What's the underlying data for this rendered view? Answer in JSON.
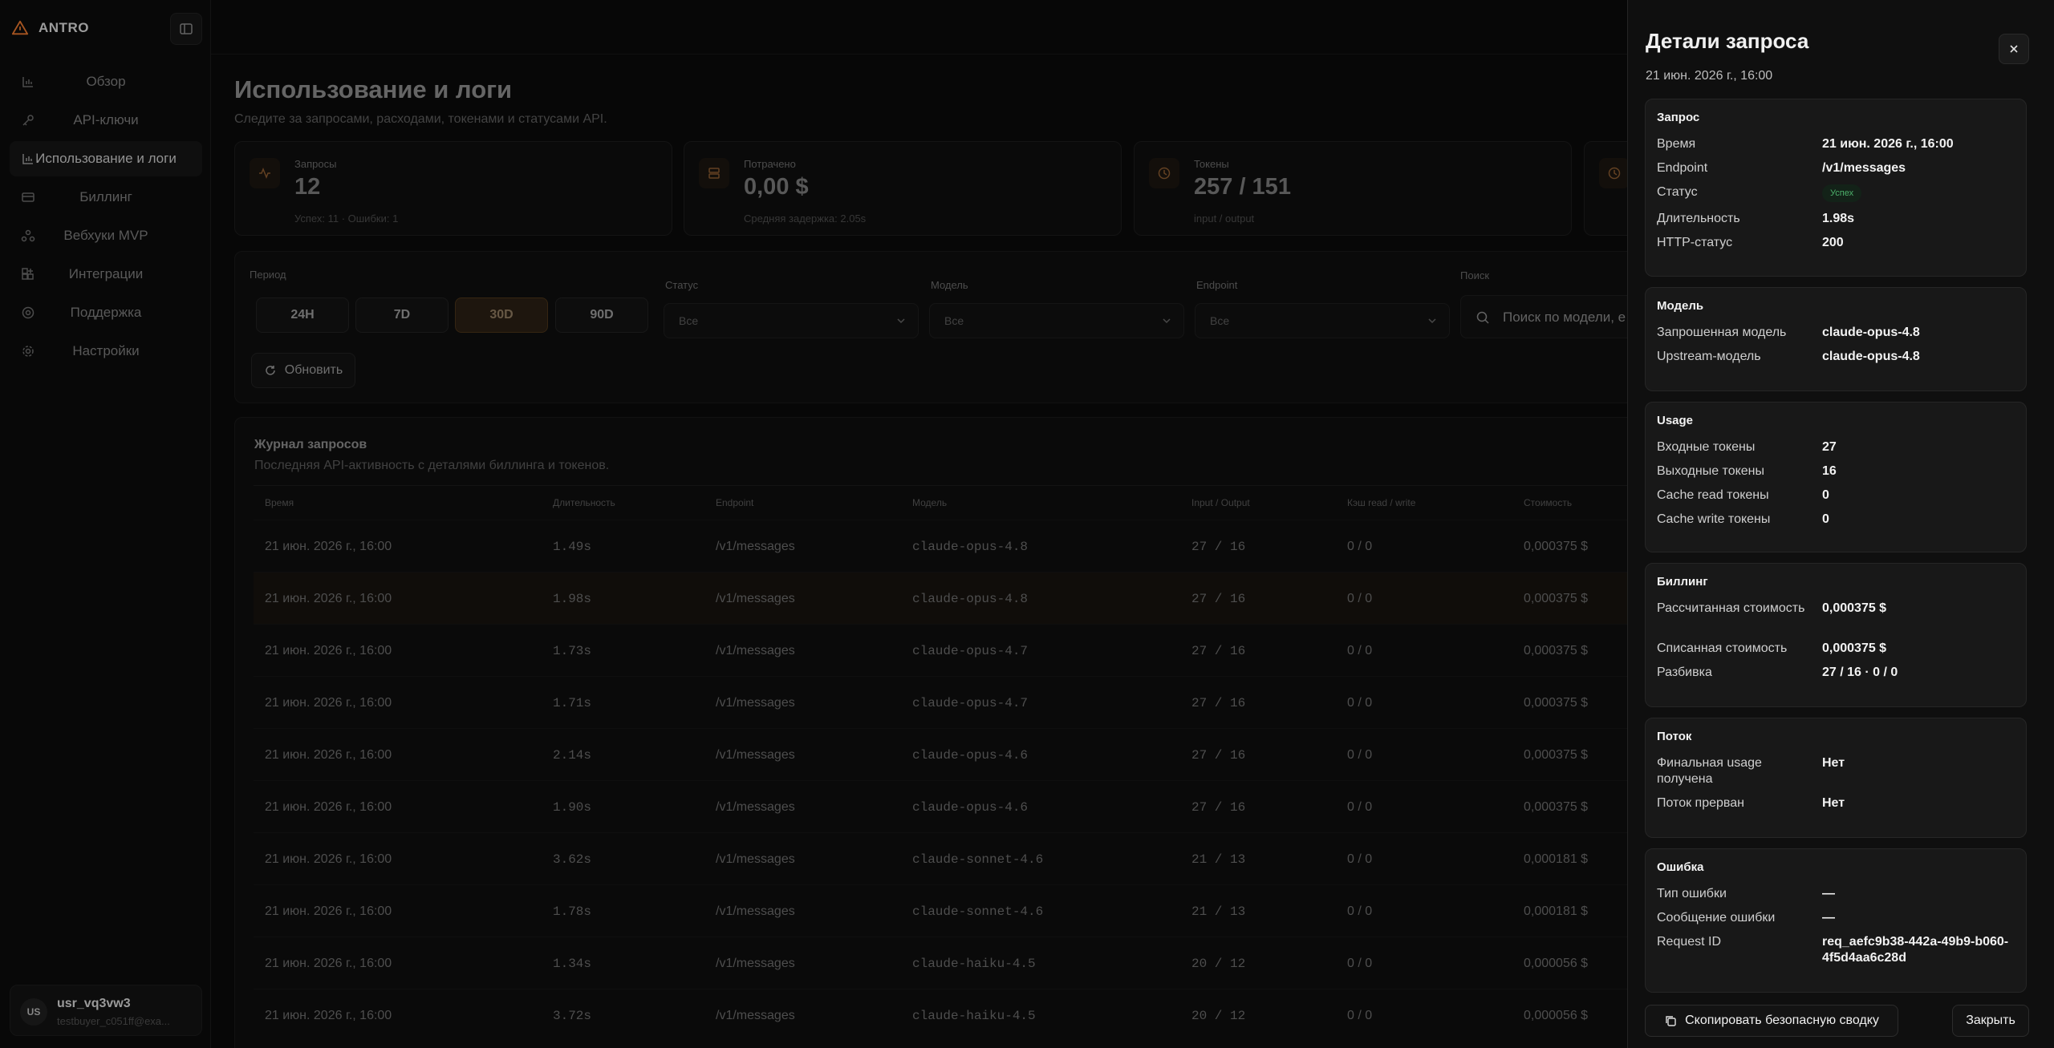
{
  "app": {
    "name": "ANTRO"
  },
  "sidebar": {
    "items": [
      {
        "label": "Обзор",
        "icon": "bar-chart-icon"
      },
      {
        "label": "API-ключи",
        "icon": "key-icon"
      },
      {
        "label": "Использование и логи",
        "icon": "bar-chart-icon",
        "active": true
      },
      {
        "label": "Биллинг",
        "icon": "credit-card-icon"
      },
      {
        "label": "Вебхуки MVP",
        "icon": "webhook-icon"
      },
      {
        "label": "Интеграции",
        "icon": "grid-plus-icon"
      },
      {
        "label": "Поддержка",
        "icon": "lifebuoy-icon"
      },
      {
        "label": "Настройки",
        "icon": "gear-icon"
      }
    ],
    "user": {
      "initials": "US",
      "name": "usr_vq3vw3",
      "email": "testbuyer_c051ff@exa..."
    }
  },
  "page": {
    "title": "Использование и логи",
    "subtitle": "Следите за запросами, расходами, токенами и статусами API."
  },
  "stats": [
    {
      "label": "Запросы",
      "value": "12",
      "sub": "Успех: 11 · Ошибки: 1",
      "icon": "activity-icon"
    },
    {
      "label": "Потрачено",
      "value": "0,00 $",
      "sub": "Средняя задержка: 2.05s",
      "icon": "stack-icon"
    },
    {
      "label": "Токены",
      "value": "257 / 151",
      "sub": "input / output",
      "icon": "clock-icon"
    },
    {
      "label": "",
      "value": "",
      "sub": "",
      "icon": "clock-icon"
    }
  ],
  "filters": {
    "period_label": "Период",
    "periods": [
      "24H",
      "7D",
      "30D",
      "90D"
    ],
    "active_period": "30D",
    "status_label": "Статус",
    "status_value": "Все",
    "model_label": "Модель",
    "model_value": "Все",
    "endpoint_label": "Endpoint",
    "endpoint_value": "Все",
    "search_label": "Поиск",
    "search_placeholder": "Поиск по модели, e",
    "refresh_label": "Обновить"
  },
  "log": {
    "title": "Журнал запросов",
    "subtitle": "Последняя API-активность с деталями биллинга и токенов.",
    "columns": [
      "Время",
      "Длительность",
      "Endpoint",
      "Модель",
      "Input / Output",
      "Кэш read / write",
      "Стоимость"
    ],
    "rows": [
      {
        "time": "21 июн. 2026 г., 16:00",
        "duration": "1.49s",
        "endpoint": "/v1/messages",
        "model": "claude-opus-4.8",
        "io": "27 / 16",
        "cache": "0 / 0",
        "cost": "0,000375 $"
      },
      {
        "time": "21 июн. 2026 г., 16:00",
        "duration": "1.98s",
        "endpoint": "/v1/messages",
        "model": "claude-opus-4.8",
        "io": "27 / 16",
        "cache": "0 / 0",
        "cost": "0,000375 $",
        "selected": true
      },
      {
        "time": "21 июн. 2026 г., 16:00",
        "duration": "1.73s",
        "endpoint": "/v1/messages",
        "model": "claude-opus-4.7",
        "io": "27 / 16",
        "cache": "0 / 0",
        "cost": "0,000375 $"
      },
      {
        "time": "21 июн. 2026 г., 16:00",
        "duration": "1.71s",
        "endpoint": "/v1/messages",
        "model": "claude-opus-4.7",
        "io": "27 / 16",
        "cache": "0 / 0",
        "cost": "0,000375 $"
      },
      {
        "time": "21 июн. 2026 г., 16:00",
        "duration": "2.14s",
        "endpoint": "/v1/messages",
        "model": "claude-opus-4.6",
        "io": "27 / 16",
        "cache": "0 / 0",
        "cost": "0,000375 $"
      },
      {
        "time": "21 июн. 2026 г., 16:00",
        "duration": "1.90s",
        "endpoint": "/v1/messages",
        "model": "claude-opus-4.6",
        "io": "27 / 16",
        "cache": "0 / 0",
        "cost": "0,000375 $"
      },
      {
        "time": "21 июн. 2026 г., 16:00",
        "duration": "3.62s",
        "endpoint": "/v1/messages",
        "model": "claude-sonnet-4.6",
        "io": "21 / 13",
        "cache": "0 / 0",
        "cost": "0,000181 $"
      },
      {
        "time": "21 июн. 2026 г., 16:00",
        "duration": "1.78s",
        "endpoint": "/v1/messages",
        "model": "claude-sonnet-4.6",
        "io": "21 / 13",
        "cache": "0 / 0",
        "cost": "0,000181 $"
      },
      {
        "time": "21 июн. 2026 г., 16:00",
        "duration": "1.34s",
        "endpoint": "/v1/messages",
        "model": "claude-haiku-4.5",
        "io": "20 / 12",
        "cache": "0 / 0",
        "cost": "0,000056 $"
      },
      {
        "time": "21 июн. 2026 г., 16:00",
        "duration": "3.72s",
        "endpoint": "/v1/messages",
        "model": "claude-haiku-4.5",
        "io": "20 / 12",
        "cache": "0 / 0",
        "cost": "0,000056 $"
      }
    ]
  },
  "panel": {
    "title": "Детали запроса",
    "date": "21 июн. 2026 г., 16:00",
    "sections": {
      "request": {
        "title": "Запрос",
        "rows": [
          {
            "k": "Время",
            "v": "21 июн. 2026 г., 16:00"
          },
          {
            "k": "Endpoint",
            "v": "/v1/messages"
          },
          {
            "k": "Статус",
            "v": "Успех"
          },
          {
            "k": "Длительность",
            "v": "1.98s"
          },
          {
            "k": "HTTP-статус",
            "v": "200"
          }
        ]
      },
      "model": {
        "title": "Модель",
        "rows": [
          {
            "k": "Запрошенная модель",
            "v": "claude-opus-4.8"
          },
          {
            "k": "Upstream-модель",
            "v": "claude-opus-4.8"
          }
        ]
      },
      "usage": {
        "title": "Usage",
        "rows": [
          {
            "k": "Входные токены",
            "v": "27"
          },
          {
            "k": "Выходные токены",
            "v": "16"
          },
          {
            "k": "Cache read токены",
            "v": "0"
          },
          {
            "k": "Cache write токены",
            "v": "0"
          }
        ]
      },
      "billing": {
        "title": "Биллинг",
        "rows": [
          {
            "k": "Рассчитанная стоимость",
            "v": "0,000375 $"
          },
          {
            "k": "Списанная стоимость",
            "v": "0,000375 $"
          },
          {
            "k": "Разбивка",
            "v": "27 / 16 · 0 / 0"
          }
        ]
      },
      "stream": {
        "title": "Поток",
        "rows": [
          {
            "k": "Финальная usage получена",
            "v": "Нет"
          },
          {
            "k": "Поток прерван",
            "v": "Нет"
          }
        ]
      },
      "error": {
        "title": "Ошибка",
        "rows": [
          {
            "k": "Тип ошибки",
            "v": "—"
          },
          {
            "k": "Сообщение ошибки",
            "v": "—"
          },
          {
            "k": "Request ID",
            "v": "req_aefc9b38-442a-49b9-b060-4f5d4aa6c28d"
          }
        ]
      }
    },
    "copy_label": "Скопировать безопасную сводку",
    "close_label": "Закрыть"
  },
  "colors": {
    "accent": "#e8772e",
    "success": "#4caf6a",
    "background": "#0b0b0b",
    "panel": "#0f0f0f"
  }
}
